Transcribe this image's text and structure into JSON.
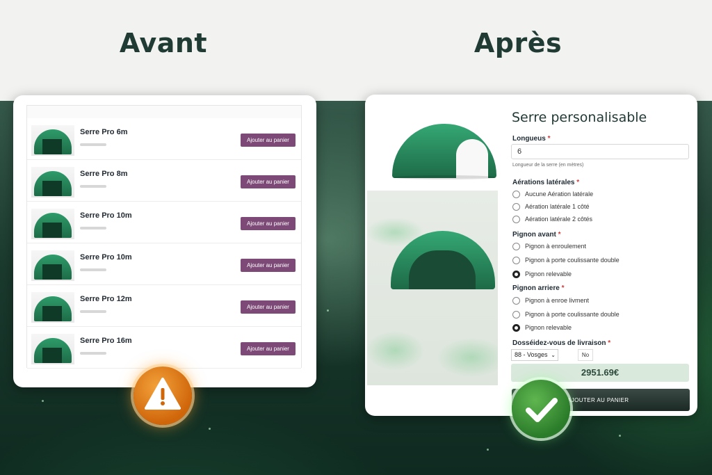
{
  "headings": {
    "before": "Avant",
    "after": "Après"
  },
  "before": {
    "add_to_cart_label": "Ajouter au panier",
    "products": [
      {
        "name": "Serre Pro 6m"
      },
      {
        "name": "Serre Pro 8m"
      },
      {
        "name": "Serre Pro 10m"
      },
      {
        "name": "Serre Pro 10m"
      },
      {
        "name": "Serre Pro 12m"
      },
      {
        "name": "Serre Pro 16m"
      }
    ],
    "badge_icon": "warning-icon"
  },
  "after": {
    "title": "Serre personalisable",
    "length": {
      "label": "Longueus",
      "required": "*",
      "value": "6",
      "help": "Longueur de la serre (en mètres)"
    },
    "side_vents": {
      "label": "Aérations latérales",
      "required": "*",
      "options": [
        "Aucune Aération latérale",
        "Aération latérale 1 côté",
        "Aération latérale 2 côtés"
      ],
      "selected": null
    },
    "front_gable": {
      "label": "Pignon avant",
      "required": "*",
      "options": [
        "Pignon à enroulement",
        "Pignon à porte coulissante double",
        "Pignon relevable"
      ],
      "selected": 2
    },
    "rear_gable": {
      "label": "Pignon arriere",
      "required": "*",
      "options": [
        "Pignon à enroe livment",
        "Pignon à porte coulissante double",
        "Pignon relevable"
      ],
      "selected": 2
    },
    "delivery": {
      "label": "Dosséidez-vous de livraison",
      "required": "*",
      "select_value": "88 - Vosges",
      "no_label": "No"
    },
    "price": "2951.69€",
    "cart_button": "AJOUTER AU PANIER",
    "badge_icon": "check-icon"
  },
  "colors": {
    "accent_purple": "#7d4a78",
    "brand_green": "#1d6a47",
    "price_bg": "#d9e9dc"
  }
}
